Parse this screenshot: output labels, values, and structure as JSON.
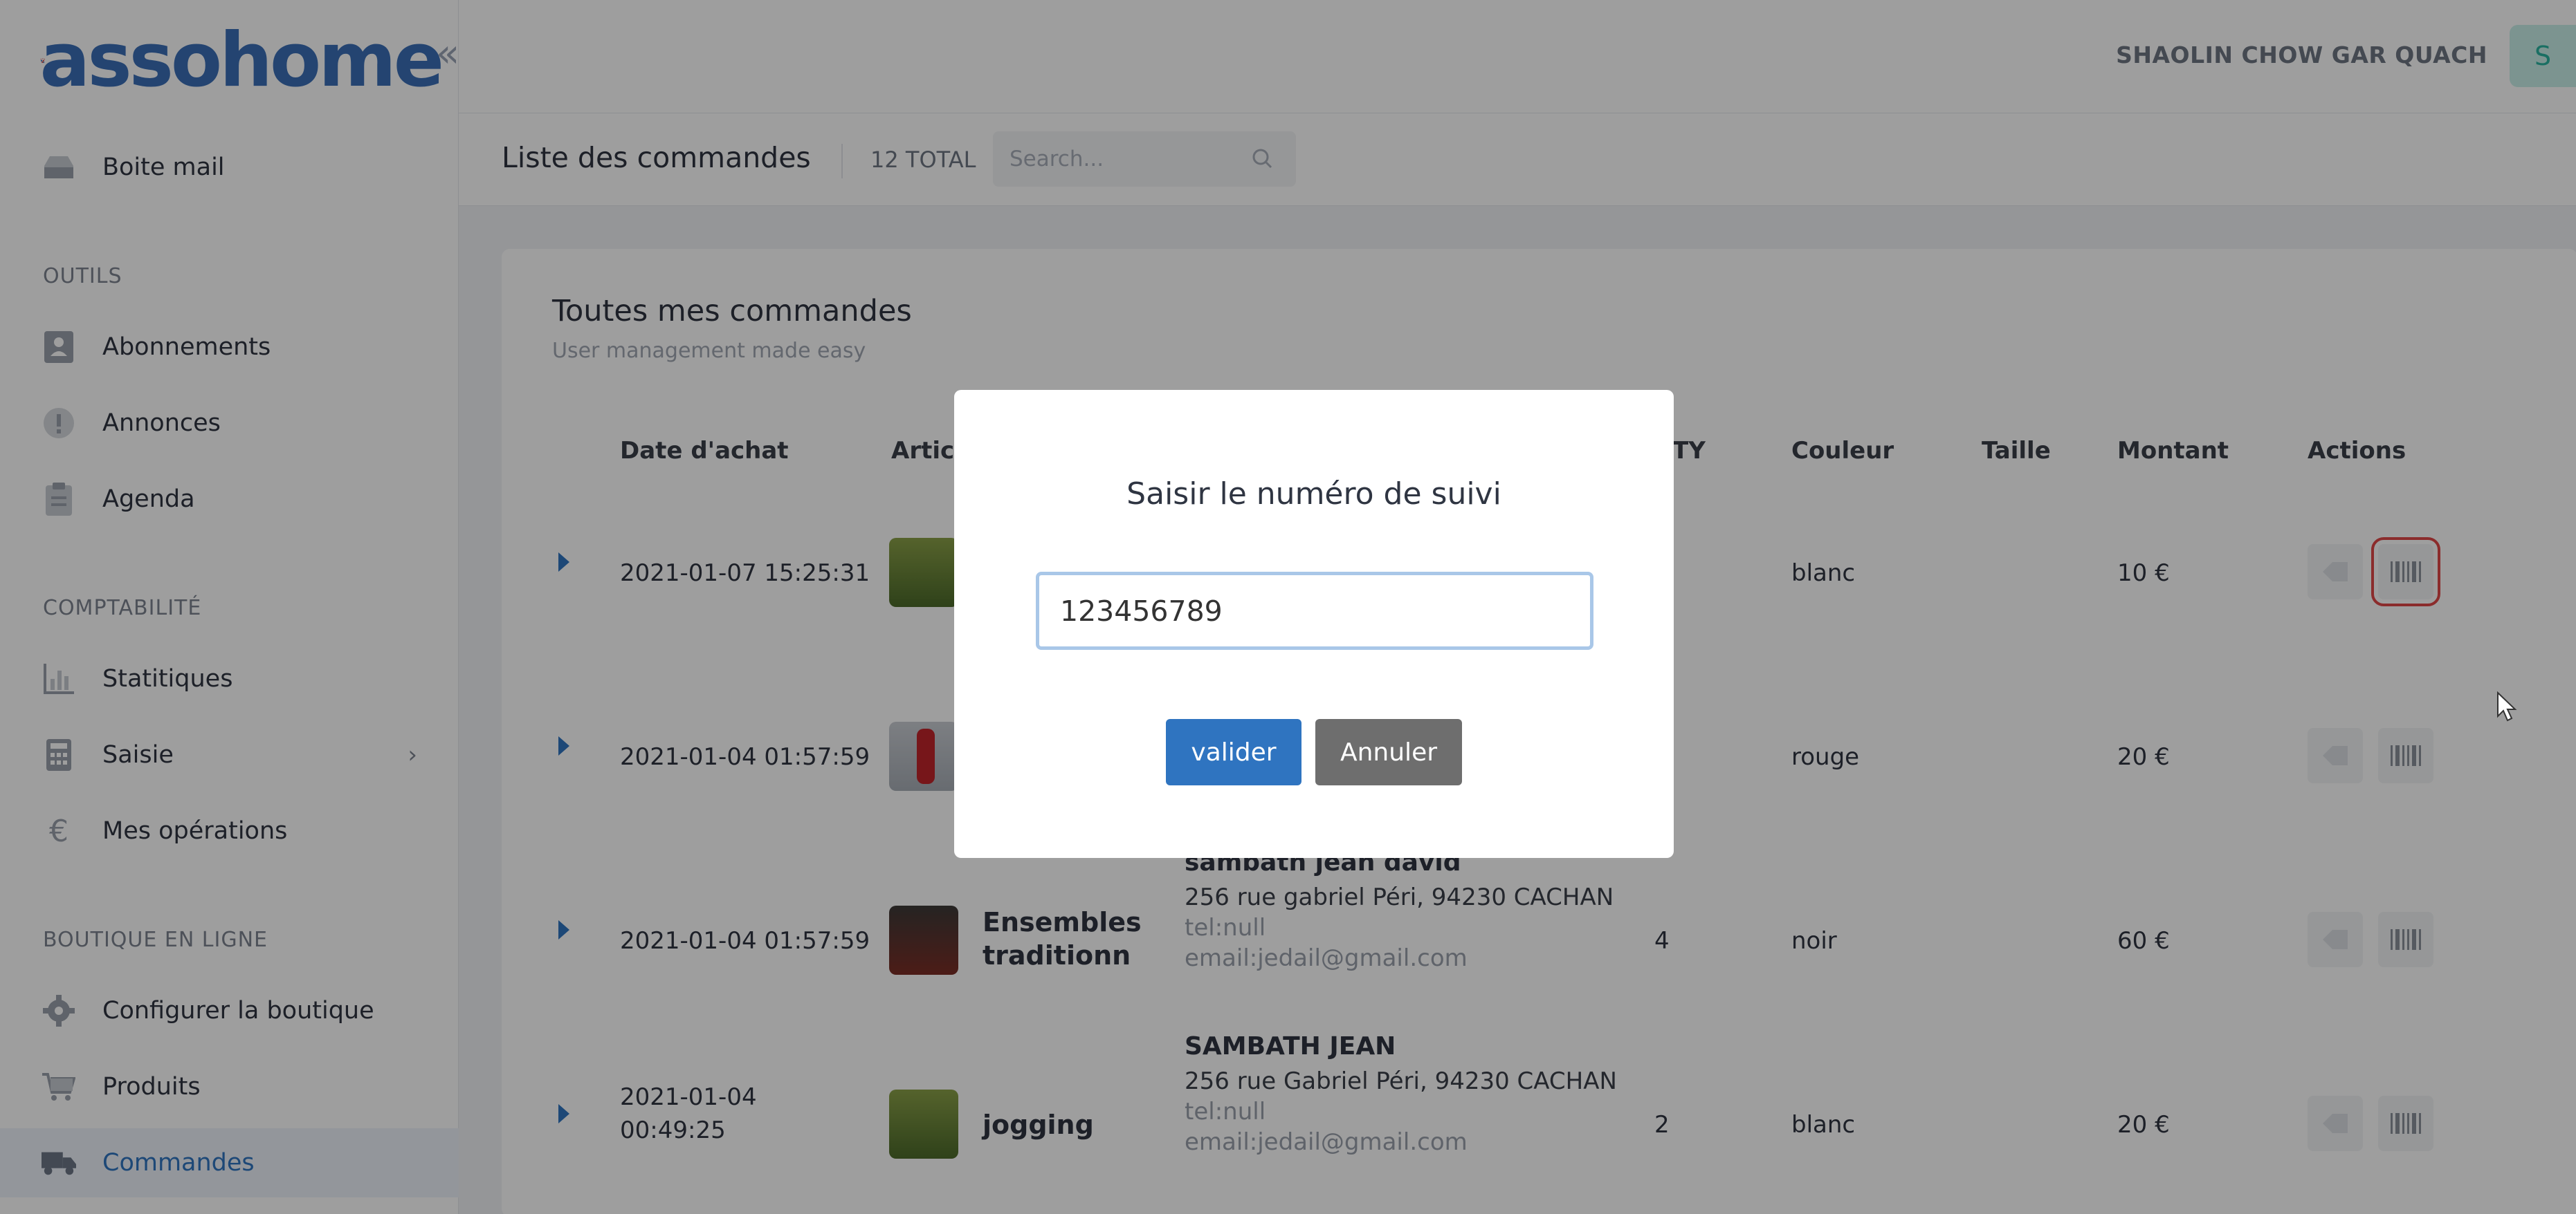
{
  "brand": {
    "name": "assohome"
  },
  "sidebar": {
    "top_item": "Boite mail",
    "sections": [
      {
        "title": "OUTILS",
        "items": [
          "Abonnements",
          "Annonces",
          "Agenda"
        ]
      },
      {
        "title": "COMPTABILITÉ",
        "items": [
          "Statitiques",
          "Saisie",
          "Mes opérations"
        ]
      },
      {
        "title": "BOUTIQUE EN LIGNE",
        "items": [
          "Configurer la boutique",
          "Produits",
          "Commandes"
        ]
      }
    ],
    "active": "Commandes"
  },
  "topbar": {
    "user_name": "SHAOLIN CHOW GAR QUACH",
    "avatar_initial": "S"
  },
  "subheader": {
    "title": "Liste des commandes",
    "total": "12 TOTAL",
    "search_placeholder": "Search..."
  },
  "card": {
    "title": "Toutes mes commandes",
    "subtitle": "User management made easy",
    "columns": [
      "Date d'achat",
      "Article",
      "TY",
      "Couleur",
      "Taille",
      "Montant",
      "Actions"
    ],
    "rows": [
      {
        "date": "2021-01-07 15:25:31",
        "article": "",
        "name": "",
        "address": "",
        "tel": "",
        "email": "",
        "qty": "",
        "color": "blanc",
        "size": "",
        "amount": "10 €"
      },
      {
        "date": "2021-01-04 01:57:59",
        "article": "",
        "name": "",
        "address": "",
        "tel": "",
        "email": "",
        "qty": "",
        "color": "rouge",
        "size": "",
        "amount": "20 €"
      },
      {
        "date": "2021-01-04 01:57:59",
        "article": "Ensembles traditionn",
        "name": "sambath jean david",
        "address": "256 rue gabriel Péri, 94230 CACHAN",
        "tel": "tel:null",
        "email": "email:jedail@gmail.com",
        "qty": "4",
        "color": "noir",
        "size": "",
        "amount": "60 €"
      },
      {
        "date": "2021-01-04 00:49:25",
        "article": "jogging",
        "name": "SAMBATH JEAN",
        "address": "256 rue Gabriel Péri, 94230 CACHAN",
        "tel": "tel:null",
        "email": "email:jedail@gmail.com",
        "qty": "2",
        "color": "blanc",
        "size": "",
        "amount": "20 €"
      }
    ]
  },
  "modal": {
    "title": "Saisir le numéro de suivi",
    "input_value": "123456789",
    "validate_label": "valider",
    "cancel_label": "Annuler"
  },
  "colors": {
    "primary": "#2f74c0",
    "cancel": "#6e6e6e",
    "highlight": "#e04848"
  }
}
